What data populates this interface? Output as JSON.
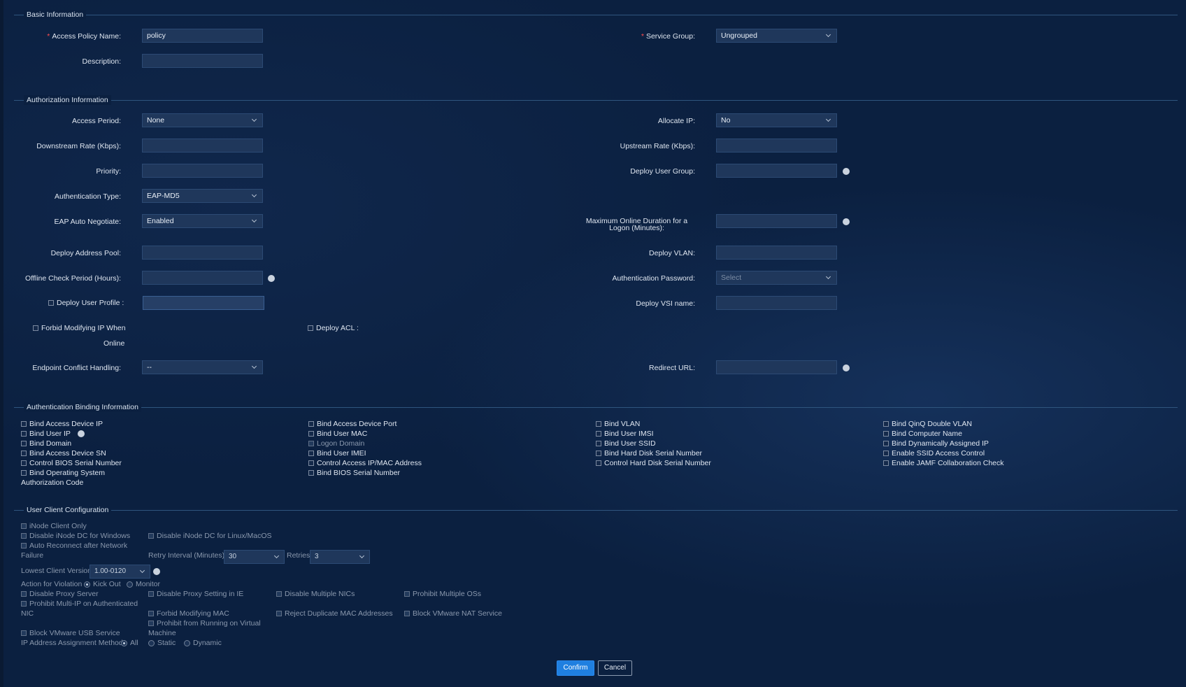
{
  "basic": {
    "title": "Basic Information",
    "policy_name_label": "Access Policy Name:",
    "policy_name_value": "policy",
    "description_label": "Description:",
    "description_value": "",
    "service_group_label": "Service Group:",
    "service_group_value": "Ungrouped"
  },
  "auth": {
    "title": "Authorization Information",
    "access_period_label": "Access Period:",
    "access_period_value": "None",
    "allocate_ip_label": "Allocate IP:",
    "allocate_ip_value": "No",
    "downstream_label": "Downstream Rate (Kbps):",
    "upstream_label": "Upstream Rate (Kbps):",
    "priority_label": "Priority:",
    "deploy_user_group_label": "Deploy User Group:",
    "auth_type_label": "Authentication Type:",
    "auth_type_value": "EAP-MD5",
    "eap_label": "EAP Auto Negotiate:",
    "eap_value": "Enabled",
    "max_online_label_1": "Maximum Online Duration for a",
    "max_online_label_2": "Logon (Minutes):",
    "deploy_address_pool_label": "Deploy Address Pool:",
    "deploy_vlan_label": "Deploy VLAN:",
    "offline_check_label": "Offline Check Period (Hours):",
    "auth_password_label": "Authentication Password:",
    "auth_password_placeholder": "Select",
    "deploy_user_profile_label": "Deploy User Profile :",
    "deploy_vsi_label": "Deploy VSI name:",
    "forbid_modify_ip_label_1": "Forbid Modifying IP When",
    "forbid_modify_ip_label_2": "Online",
    "deploy_acl_label": "Deploy ACL :",
    "endpoint_conflict_label": "Endpoint Conflict Handling:",
    "endpoint_conflict_value": "--",
    "redirect_url_label": "Redirect URL:"
  },
  "binding": {
    "title": "Authentication Binding Information",
    "col1": [
      "Bind Access Device IP",
      "Bind User IP",
      "Bind Domain",
      "Bind Access Device SN",
      "Control BIOS Serial Number",
      "Bind Operating System"
    ],
    "col1_extra": "Authorization Code",
    "col2": [
      "Bind Access Device Port",
      "Bind User MAC",
      "Logon Domain",
      "Bind User IMEI",
      "Control Access IP/MAC Address",
      "Bind BIOS Serial Number"
    ],
    "col3": [
      "Bind VLAN",
      "Bind User IMSI",
      "Bind User SSID",
      "Bind Hard Disk Serial Number",
      "Control Hard Disk Serial Number"
    ],
    "col4": [
      "Bind QinQ Double VLAN",
      "Bind Computer Name",
      "Bind Dynamically Assigned IP",
      "Enable SSID Access Control",
      "Enable JAMF Collaboration Check"
    ]
  },
  "client": {
    "title": "User Client Configuration",
    "inode_only": "iNode Client Only",
    "disable_dc_windows": "Disable iNode DC for Windows",
    "disable_dc_linux": "Disable iNode DC for Linux/MacOS",
    "auto_reconnect_1": "Auto Reconnect after Network",
    "auto_reconnect_2": "Failure",
    "retry_interval_label": "Retry Interval (Minutes)",
    "retry_interval_value": "30",
    "retries_label": "Retries",
    "retries_value": "3",
    "lowest_version_label": "Lowest Client Version",
    "lowest_version_value": "1.00-0120",
    "action_violation_label": "Action for Violation",
    "kick_out": "Kick Out",
    "monitor": "Monitor",
    "disable_proxy_server": "Disable Proxy Server",
    "disable_proxy_ie": "Disable Proxy Setting in IE",
    "disable_multi_nics": "Disable Multiple NICs",
    "prohibit_multi_os": "Prohibit Multiple OSs",
    "prohibit_multi_ip_1": "Prohibit Multi-IP on Authenticated",
    "prohibit_multi_ip_2": "NIC",
    "forbid_modify_mac": "Forbid Modifying MAC",
    "reject_dup_mac": "Reject Duplicate MAC Addresses",
    "block_vmware_nat": "Block VMware NAT Service",
    "prohibit_vm_1": "Prohibit from Running on Virtual",
    "prohibit_vm_2": "Machine",
    "block_vmware_usb": "Block VMware USB Service",
    "ip_assign_label": "IP Address Assignment Method",
    "ip_all": "All",
    "ip_static": "Static",
    "ip_dynamic": "Dynamic"
  },
  "actions": {
    "confirm": "Confirm",
    "cancel": "Cancel"
  },
  "colors": {
    "background": "#0b2040",
    "input": "#1f375b",
    "primary": "#1f7fe0",
    "required": "#ff4d4f"
  }
}
